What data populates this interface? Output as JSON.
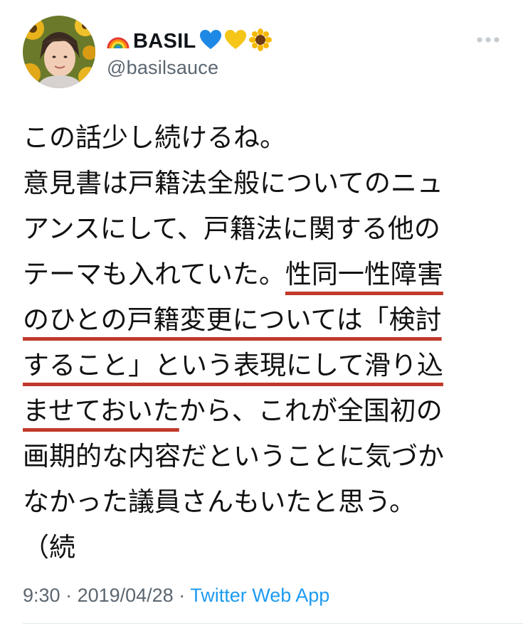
{
  "author": {
    "display_name": "BASIL",
    "name_emojis": [
      "rainbow-icon",
      "blue-heart-icon",
      "yellow-heart-icon",
      "sunflower-icon"
    ],
    "handle": "@basilsauce"
  },
  "tweet": {
    "lines": [
      [
        "この話少し続けるね。"
      ],
      [
        "意見書は戸籍法全般についてのニュ"
      ],
      [
        "アンスにして、戸籍法に関する他の"
      ],
      [
        "テーマも入れていた。",
        "性同一性障害"
      ],
      [
        "のひとの戸籍変更については「検討"
      ],
      [
        "すること」という表現にして滑り込"
      ],
      [
        "ませておいた",
        "から、これが全国初の"
      ],
      [
        "画期的な内容だということに気づか"
      ],
      [
        "なかった議員さんもいたと思う。"
      ],
      [
        "（続"
      ]
    ]
  },
  "meta": {
    "time": "9:30",
    "separator": " · ",
    "date": "2019/04/28",
    "app": "Twitter Web App"
  },
  "colors": {
    "underline": "#c0392b",
    "link": "#1d9bf0",
    "secondary_text": "#5b6670"
  }
}
